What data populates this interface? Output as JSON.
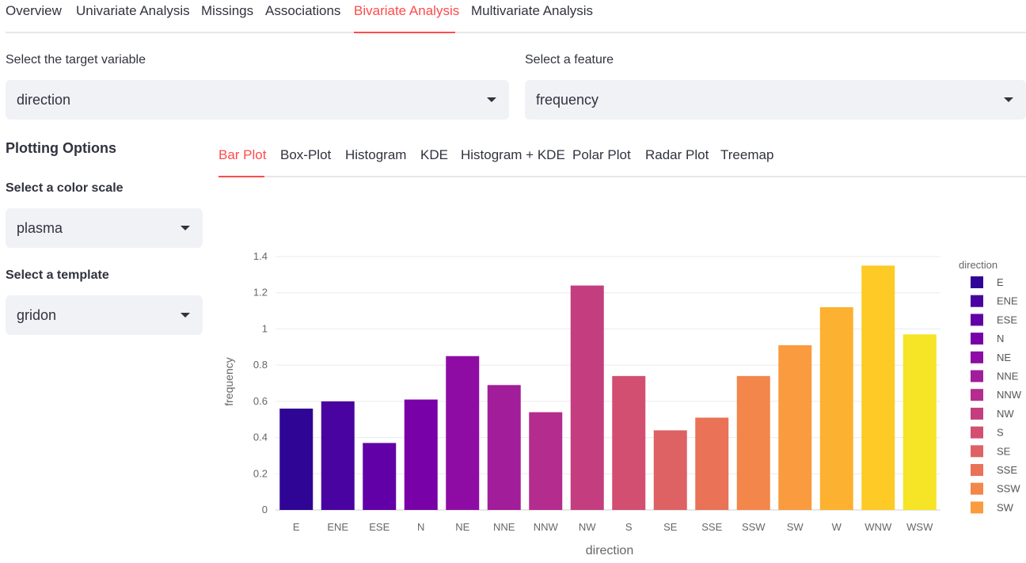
{
  "top_tabs": [
    "Overview",
    "Univariate Analysis",
    "Missings",
    "Associations",
    "Bivariate Analysis",
    "Multivariate Analysis"
  ],
  "target": {
    "label": "Select the target variable",
    "value": "direction"
  },
  "feature": {
    "label": "Select a feature",
    "value": "frequency"
  },
  "sidebar": {
    "heading": "Plotting Options",
    "color_scale_label": "Select a color scale",
    "color_scale_value": "plasma",
    "template_label": "Select a template",
    "template_value": "gridon"
  },
  "plot_tabs": [
    "Bar Plot",
    "Box-Plot",
    "Histogram",
    "KDE",
    "Histogram + KDE",
    "Polar Plot",
    "Radar Plot",
    "Treemap"
  ],
  "colors": {
    "accent": "#ff4b4b",
    "select_bg": "#f0f2f6",
    "text": "#31333f"
  },
  "chart_data": {
    "type": "bar",
    "xlabel": "direction",
    "ylabel": "frequency",
    "ylim": [
      0,
      1.4
    ],
    "yticks": [
      "0",
      "0.2",
      "0.4",
      "0.6",
      "0.8",
      "1",
      "1.2",
      "1.4"
    ],
    "grid": true,
    "legend_title": "direction",
    "legend_position": "right",
    "categories": [
      "E",
      "ENE",
      "ESE",
      "N",
      "NE",
      "NNE",
      "NNW",
      "NW",
      "S",
      "SE",
      "SSE",
      "SSW",
      "SW",
      "W",
      "WNW",
      "WSW"
    ],
    "values": [
      0.56,
      0.6,
      0.37,
      0.61,
      0.85,
      0.69,
      0.54,
      1.24,
      0.74,
      0.44,
      0.51,
      0.74,
      0.91,
      1.12,
      1.35,
      0.97
    ],
    "bar_colors": [
      "#2f0596",
      "#4903a0",
      "#6100a7",
      "#7801a8",
      "#8e0ca4",
      "#a21d9a",
      "#b32c8e",
      "#c43e7f",
      "#d24f71",
      "#de6164",
      "#e97257",
      "#f3864a",
      "#f99b3e",
      "#fdb130",
      "#fdca26",
      "#f6e426"
    ],
    "legend_visible": [
      "E",
      "ENE",
      "ESE",
      "N",
      "NE",
      "NNE",
      "NNW",
      "NW",
      "S",
      "SE",
      "SSE",
      "SSW",
      "SW"
    ]
  }
}
